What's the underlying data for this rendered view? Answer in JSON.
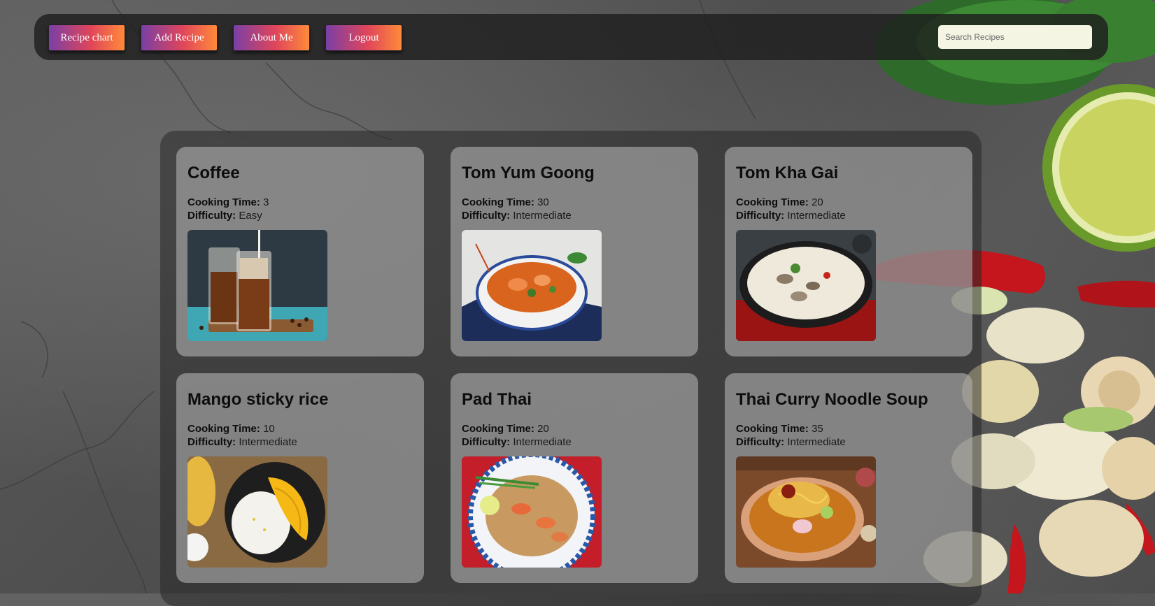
{
  "nav": {
    "buttons": [
      {
        "label": "Recipe chart"
      },
      {
        "label": "Add Recipe"
      },
      {
        "label": "About Me"
      },
      {
        "label": "Logout"
      }
    ],
    "search_placeholder": "Search Recipes"
  },
  "recipes": [
    {
      "title": "Coffee",
      "cooking_time_label": "Cooking Time:",
      "cooking_time": "3",
      "difficulty_label": "Difficulty:",
      "difficulty": "Easy",
      "image": "iced-coffee-photo"
    },
    {
      "title": "Tom Yum Goong",
      "cooking_time_label": "Cooking Time:",
      "cooking_time": "30",
      "difficulty_label": "Difficulty:",
      "difficulty": "Intermediate",
      "image": "tom-yum-goong-photo"
    },
    {
      "title": "Tom Kha Gai",
      "cooking_time_label": "Cooking Time:",
      "cooking_time": "20",
      "difficulty_label": "Difficulty:",
      "difficulty": "Intermediate",
      "image": "tom-kha-gai-photo"
    },
    {
      "title": "Mango sticky rice",
      "cooking_time_label": "Cooking Time:",
      "cooking_time": "10",
      "difficulty_label": "Difficulty:",
      "difficulty": "Intermediate",
      "image": "mango-sticky-rice-photo"
    },
    {
      "title": "Pad Thai",
      "cooking_time_label": "Cooking Time:",
      "cooking_time": "20",
      "difficulty_label": "Difficulty:",
      "difficulty": "Intermediate",
      "image": "pad-thai-photo"
    },
    {
      "title": "Thai Curry Noodle Soup",
      "cooking_time_label": "Cooking Time:",
      "cooking_time": "35",
      "difficulty_label": "Difficulty:",
      "difficulty": "Intermediate",
      "image": "khao-soi-photo"
    }
  ],
  "colors": {
    "button_gradient_start": "#7a3fa6",
    "button_gradient_mid": "#e0455a",
    "button_gradient_end": "#ff8a3a",
    "search_bg": "#f4f5e2"
  }
}
